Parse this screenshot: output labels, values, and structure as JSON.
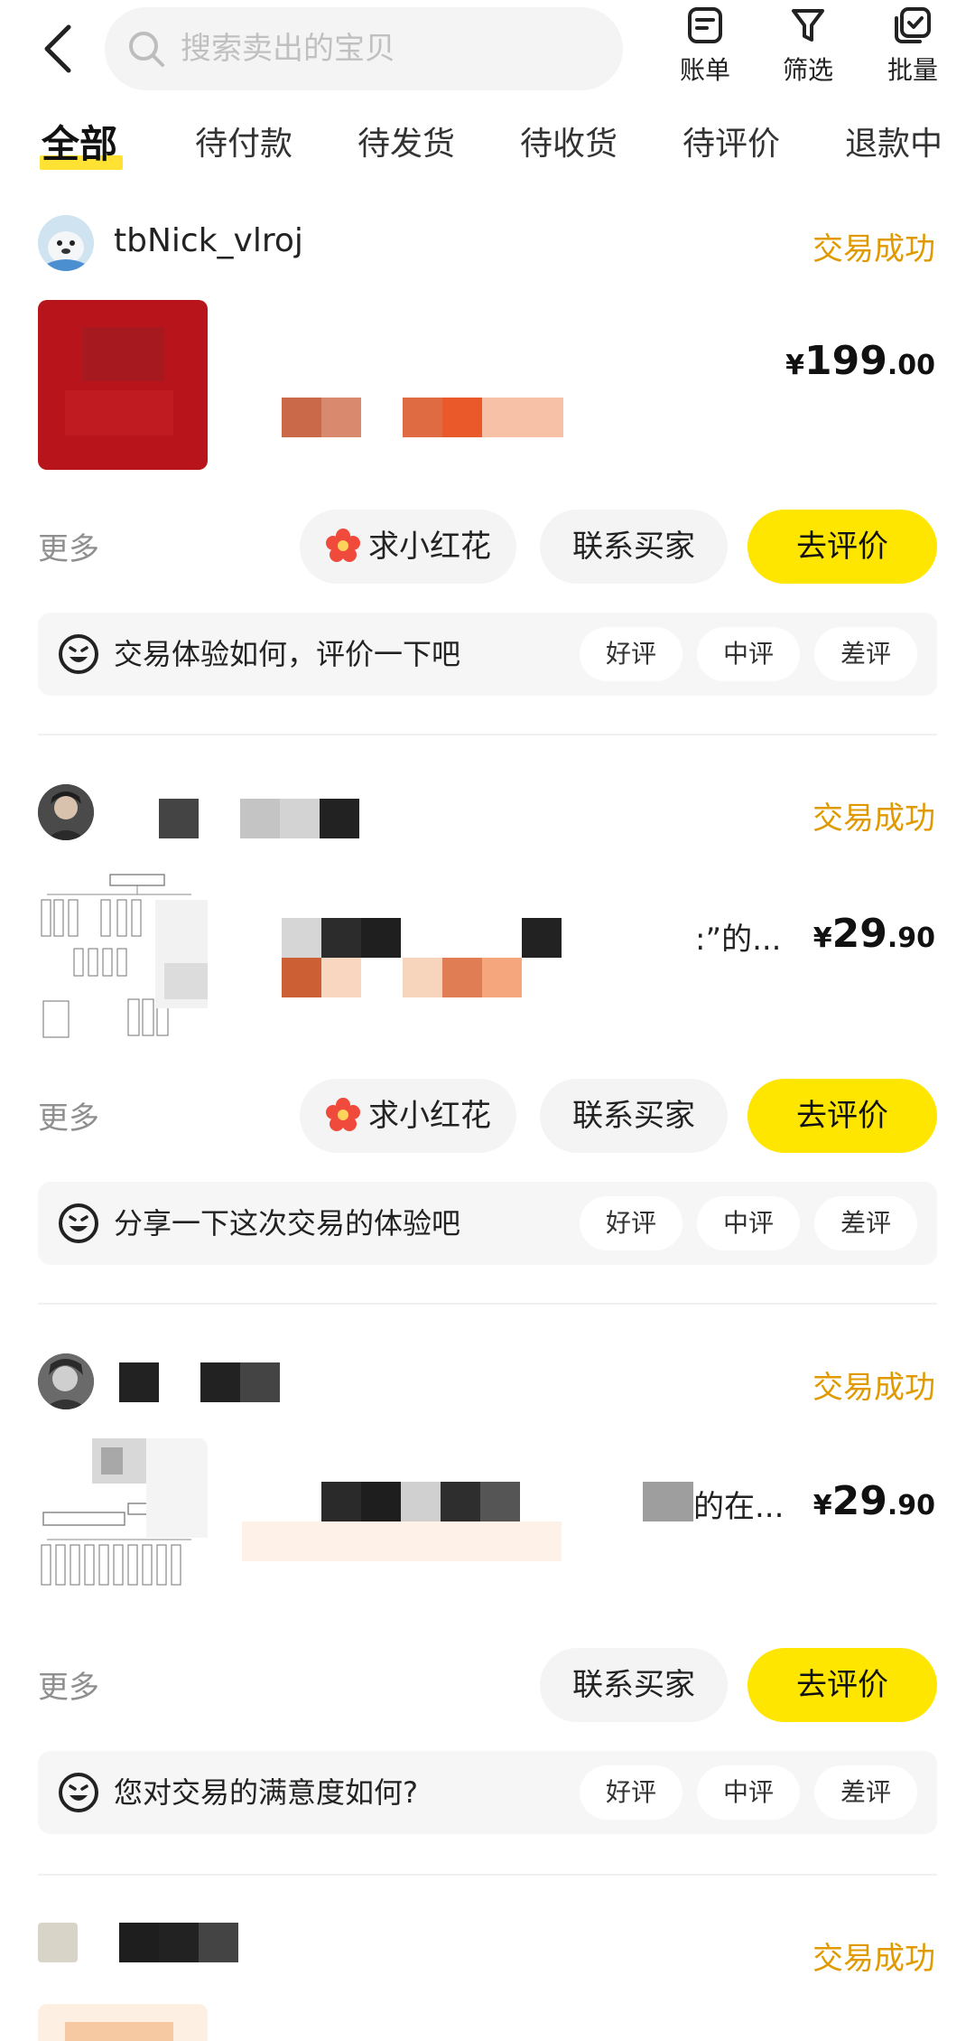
{
  "search": {
    "placeholder": "搜索卖出的宝贝"
  },
  "toolbar": [
    {
      "label": "账单",
      "icon": "bill-icon"
    },
    {
      "label": "筛选",
      "icon": "filter-icon"
    },
    {
      "label": "批量",
      "icon": "batch-icon"
    }
  ],
  "tabs": [
    {
      "label": "全部",
      "active": true
    },
    {
      "label": "待付款",
      "active": false
    },
    {
      "label": "待发货",
      "active": false
    },
    {
      "label": "待收货",
      "active": false
    },
    {
      "label": "待评价",
      "active": false
    },
    {
      "label": "退款中",
      "active": false
    }
  ],
  "orders": [
    {
      "username": "tbNick_vlroj",
      "status": "交易成功",
      "title_fragment": "",
      "price_currency": "¥",
      "price_int": "199",
      "price_dec": ".00",
      "more": "更多",
      "flower_button": "求小红花",
      "contact_button": "联系买家",
      "review_button": "去评价",
      "prompt": "交易体验如何，评价一下吧",
      "ratings": [
        "好评",
        "中评",
        "差评"
      ]
    },
    {
      "username": "",
      "status": "交易成功",
      "title_fragment": ":”的...",
      "price_currency": "¥",
      "price_int": "29",
      "price_dec": ".90",
      "more": "更多",
      "flower_button": "求小红花",
      "contact_button": "联系买家",
      "review_button": "去评价",
      "prompt": "分享一下这次交易的体验吧",
      "ratings": [
        "好评",
        "中评",
        "差评"
      ]
    },
    {
      "username": "",
      "status": "交易成功",
      "title_fragment": "的在...",
      "price_currency": "¥",
      "price_int": "29",
      "price_dec": ".90",
      "more": "更多",
      "contact_button": "联系买家",
      "review_button": "去评价",
      "prompt": "您对交易的满意度如何?",
      "ratings": [
        "好评",
        "中评",
        "差评"
      ]
    },
    {
      "username": "",
      "status": "交易成功"
    }
  ],
  "colors": {
    "accent_yellow": "#ffe600",
    "status_orange": "#e09a00",
    "muted_gray": "#8f8f8f",
    "flower_red": "#ef4a3c"
  }
}
